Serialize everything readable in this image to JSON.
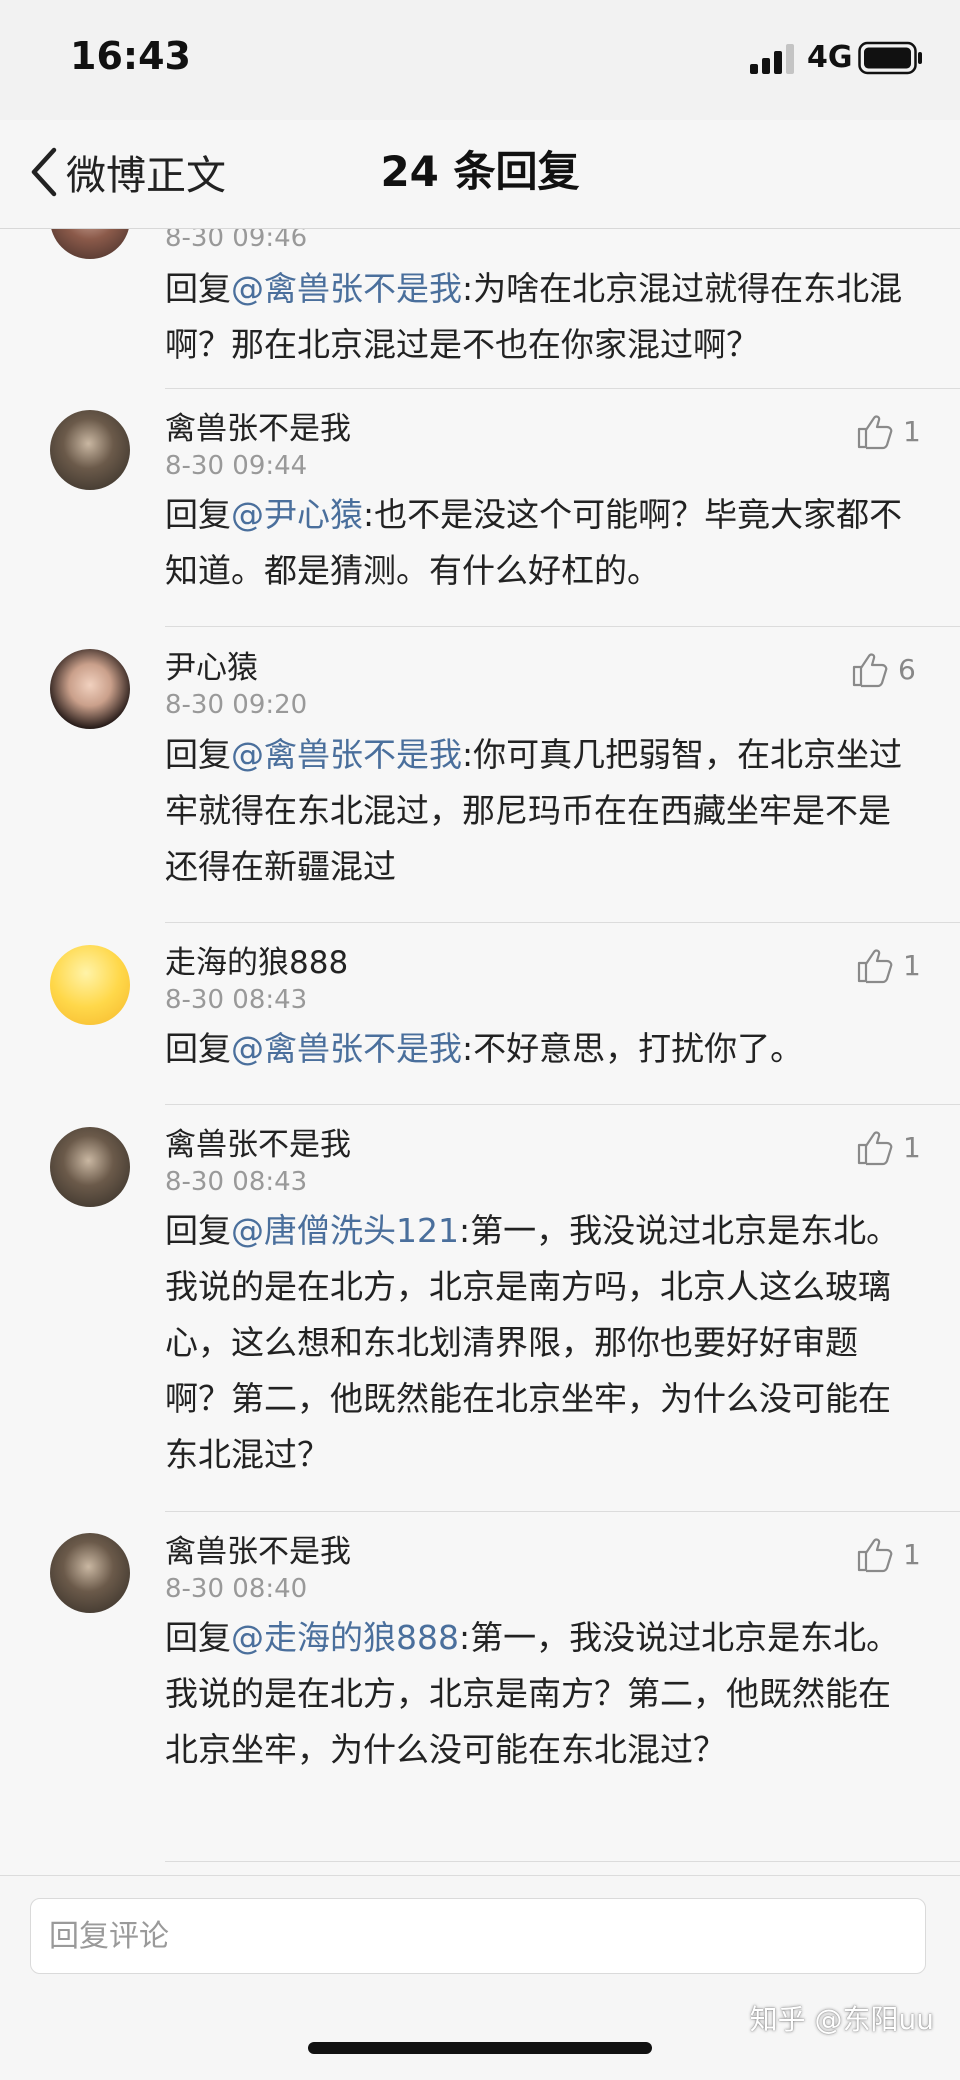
{
  "status_bar": {
    "time": "16:43",
    "network": "4G"
  },
  "nav": {
    "back_label": "微博正文",
    "title": "24 条回复"
  },
  "colors": {
    "mention": "#4a6f9c",
    "text": "#222222",
    "meta": "#999999"
  },
  "comments": [
    {
      "time": "8-30 09:46",
      "prefix": "回复",
      "mention": "@禽兽张不是我",
      "body": ":为啥在北京混过就得在东北混啊？那在北京混过是不也在你家混过啊？"
    },
    {
      "user": "禽兽张不是我",
      "time": "8-30 09:44",
      "likes": "1",
      "prefix": "回复",
      "mention": "@尹心猿",
      "body": ":也不是没这个可能啊？毕竟大家都不知道。都是猜测。有什么好杠的。"
    },
    {
      "user": "尹心猿",
      "time": "8-30 09:20",
      "likes": "6",
      "prefix": "回复",
      "mention": "@禽兽张不是我",
      "body": ":你可真几把弱智，在北京坐过牢就得在东北混过，那尼玛币在在西藏坐牢是不是还得在新疆混过"
    },
    {
      "user": "走海的狼888",
      "time": "8-30 08:43",
      "likes": "1",
      "prefix": "回复",
      "mention": "@禽兽张不是我",
      "body": ":不好意思，打扰你了。"
    },
    {
      "user": "禽兽张不是我",
      "time": "8-30 08:43",
      "likes": "1",
      "prefix": "回复",
      "mention": "@唐僧洗头121",
      "body": ":第一，我没说过北京是东北。我说的是在北方，北京是南方吗，北京人这么玻璃心，这么想和东北划清界限，那你也要好好审题啊？第二，他既然能在北京坐牢，为什么没可能在东北混过？"
    },
    {
      "user": "禽兽张不是我",
      "time": "8-30 08:40",
      "likes": "1",
      "prefix": "回复",
      "mention": "@走海的狼888",
      "body": ":第一，我没说过北京是东北。我说的是在北方，北京是南方？第二，他既然能在北京坐牢，为什么没可能在东北混过？"
    }
  ],
  "composer": {
    "placeholder": "回复评论"
  },
  "watermark": "知乎 @东阳uu"
}
